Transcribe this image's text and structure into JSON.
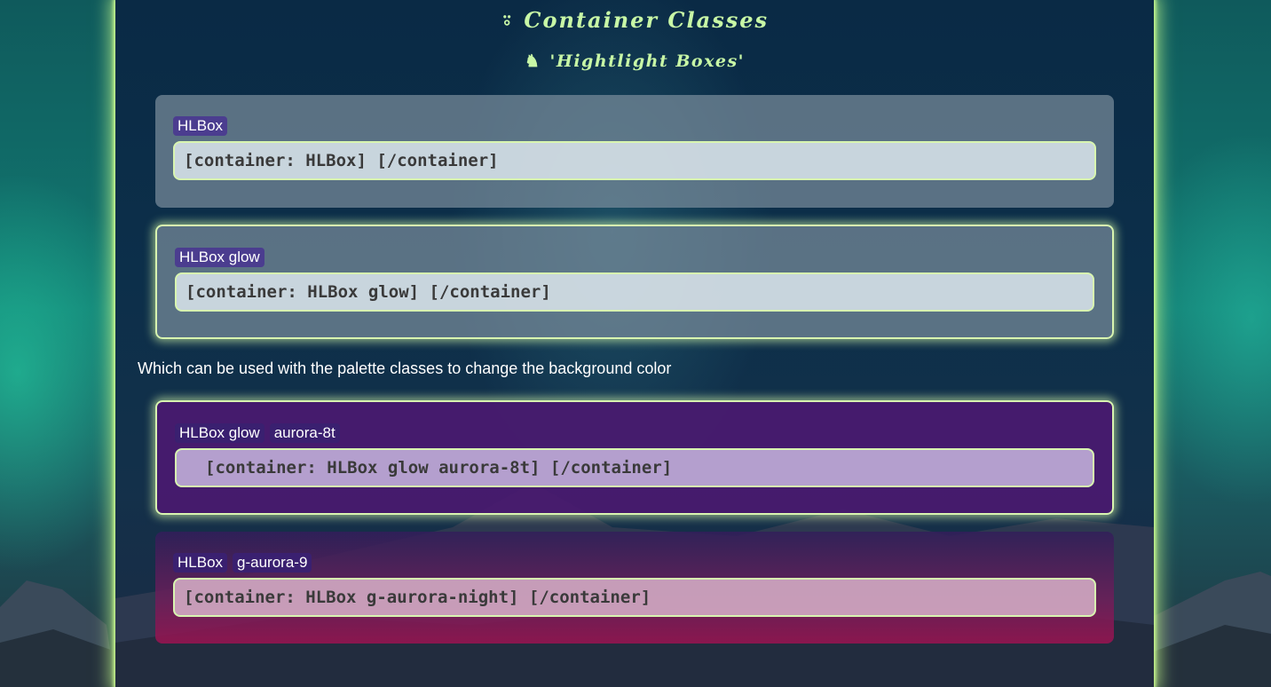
{
  "title": "Container Classes",
  "subtitle": "'Hightlight Boxes'",
  "icons": {
    "title_icon": "fox-icon",
    "subtitle_icon": "deer-icon"
  },
  "boxes": [
    {
      "tags": [
        "HLBox"
      ],
      "code": "[container: HLBox] [/container]"
    },
    {
      "tags": [
        "HLBox glow"
      ],
      "code": "[container: HLBox glow] [/container]"
    },
    {
      "tags": [
        "HLBox glow",
        "aurora-8t"
      ],
      "code": "[container: HLBox glow aurora-8t] [/container]"
    },
    {
      "tags": [
        "HLBox",
        "g-aurora-9"
      ],
      "code": "[container: HLBox g-aurora-night] [/container]"
    }
  ],
  "note": "Which can be used with the palette classes to change the background color",
  "colors": {
    "accent": "#c8f7a6",
    "glow_border": "#d8f5b0",
    "tag_bg": "#4b3d8f",
    "aurora_purple": "#4a1a70"
  }
}
